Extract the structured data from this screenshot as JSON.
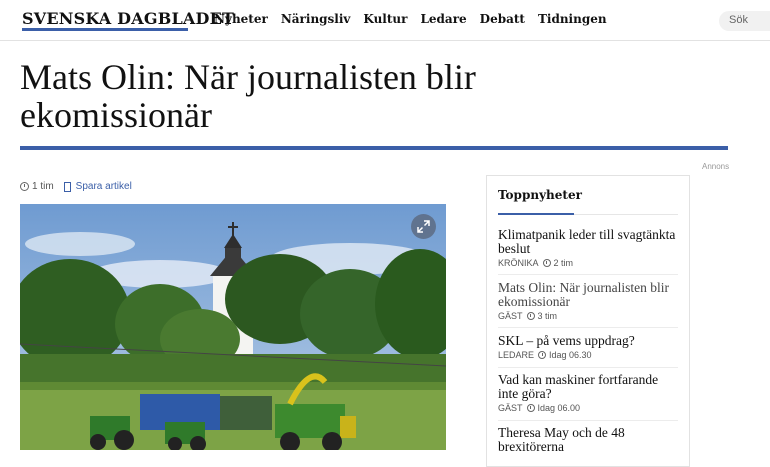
{
  "site": {
    "logo": "SVENSKA DAGBLADET"
  },
  "nav": {
    "items": [
      "Nyheter",
      "Näringsliv",
      "Kultur",
      "Ledare",
      "Debatt",
      "Tidningen"
    ]
  },
  "search": {
    "label": "Sök"
  },
  "article": {
    "headline": "Mats Olin: När journalisten blir ekomissionär",
    "time": "1 tim",
    "save_label": "Spara artikel"
  },
  "ad_label": "Annons",
  "sidebar": {
    "title": "Toppnyheter",
    "items": [
      {
        "title": "Klimatpanik leder till svagtänkta beslut",
        "category": "KRÖNIKA",
        "time": "2 tim"
      },
      {
        "title": "Mats Olin: När journalisten blir ekomissionär",
        "category": "GÄST",
        "time": "3 tim"
      },
      {
        "title": "SKL – på vems uppdrag?",
        "category": "LEDARE",
        "time": "Idag 06.30"
      },
      {
        "title": "Vad kan maskiner fortfarande inte göra?",
        "category": "GÄST",
        "time": "Idag 06.00"
      },
      {
        "title": "Theresa May och de 48 brexitörerna",
        "category": "",
        "time": ""
      }
    ]
  },
  "colors": {
    "accent": "#3b5fa8"
  },
  "icons": {
    "expand": "expand-icon",
    "clock": "clock-icon",
    "bookmark": "bookmark-icon"
  }
}
